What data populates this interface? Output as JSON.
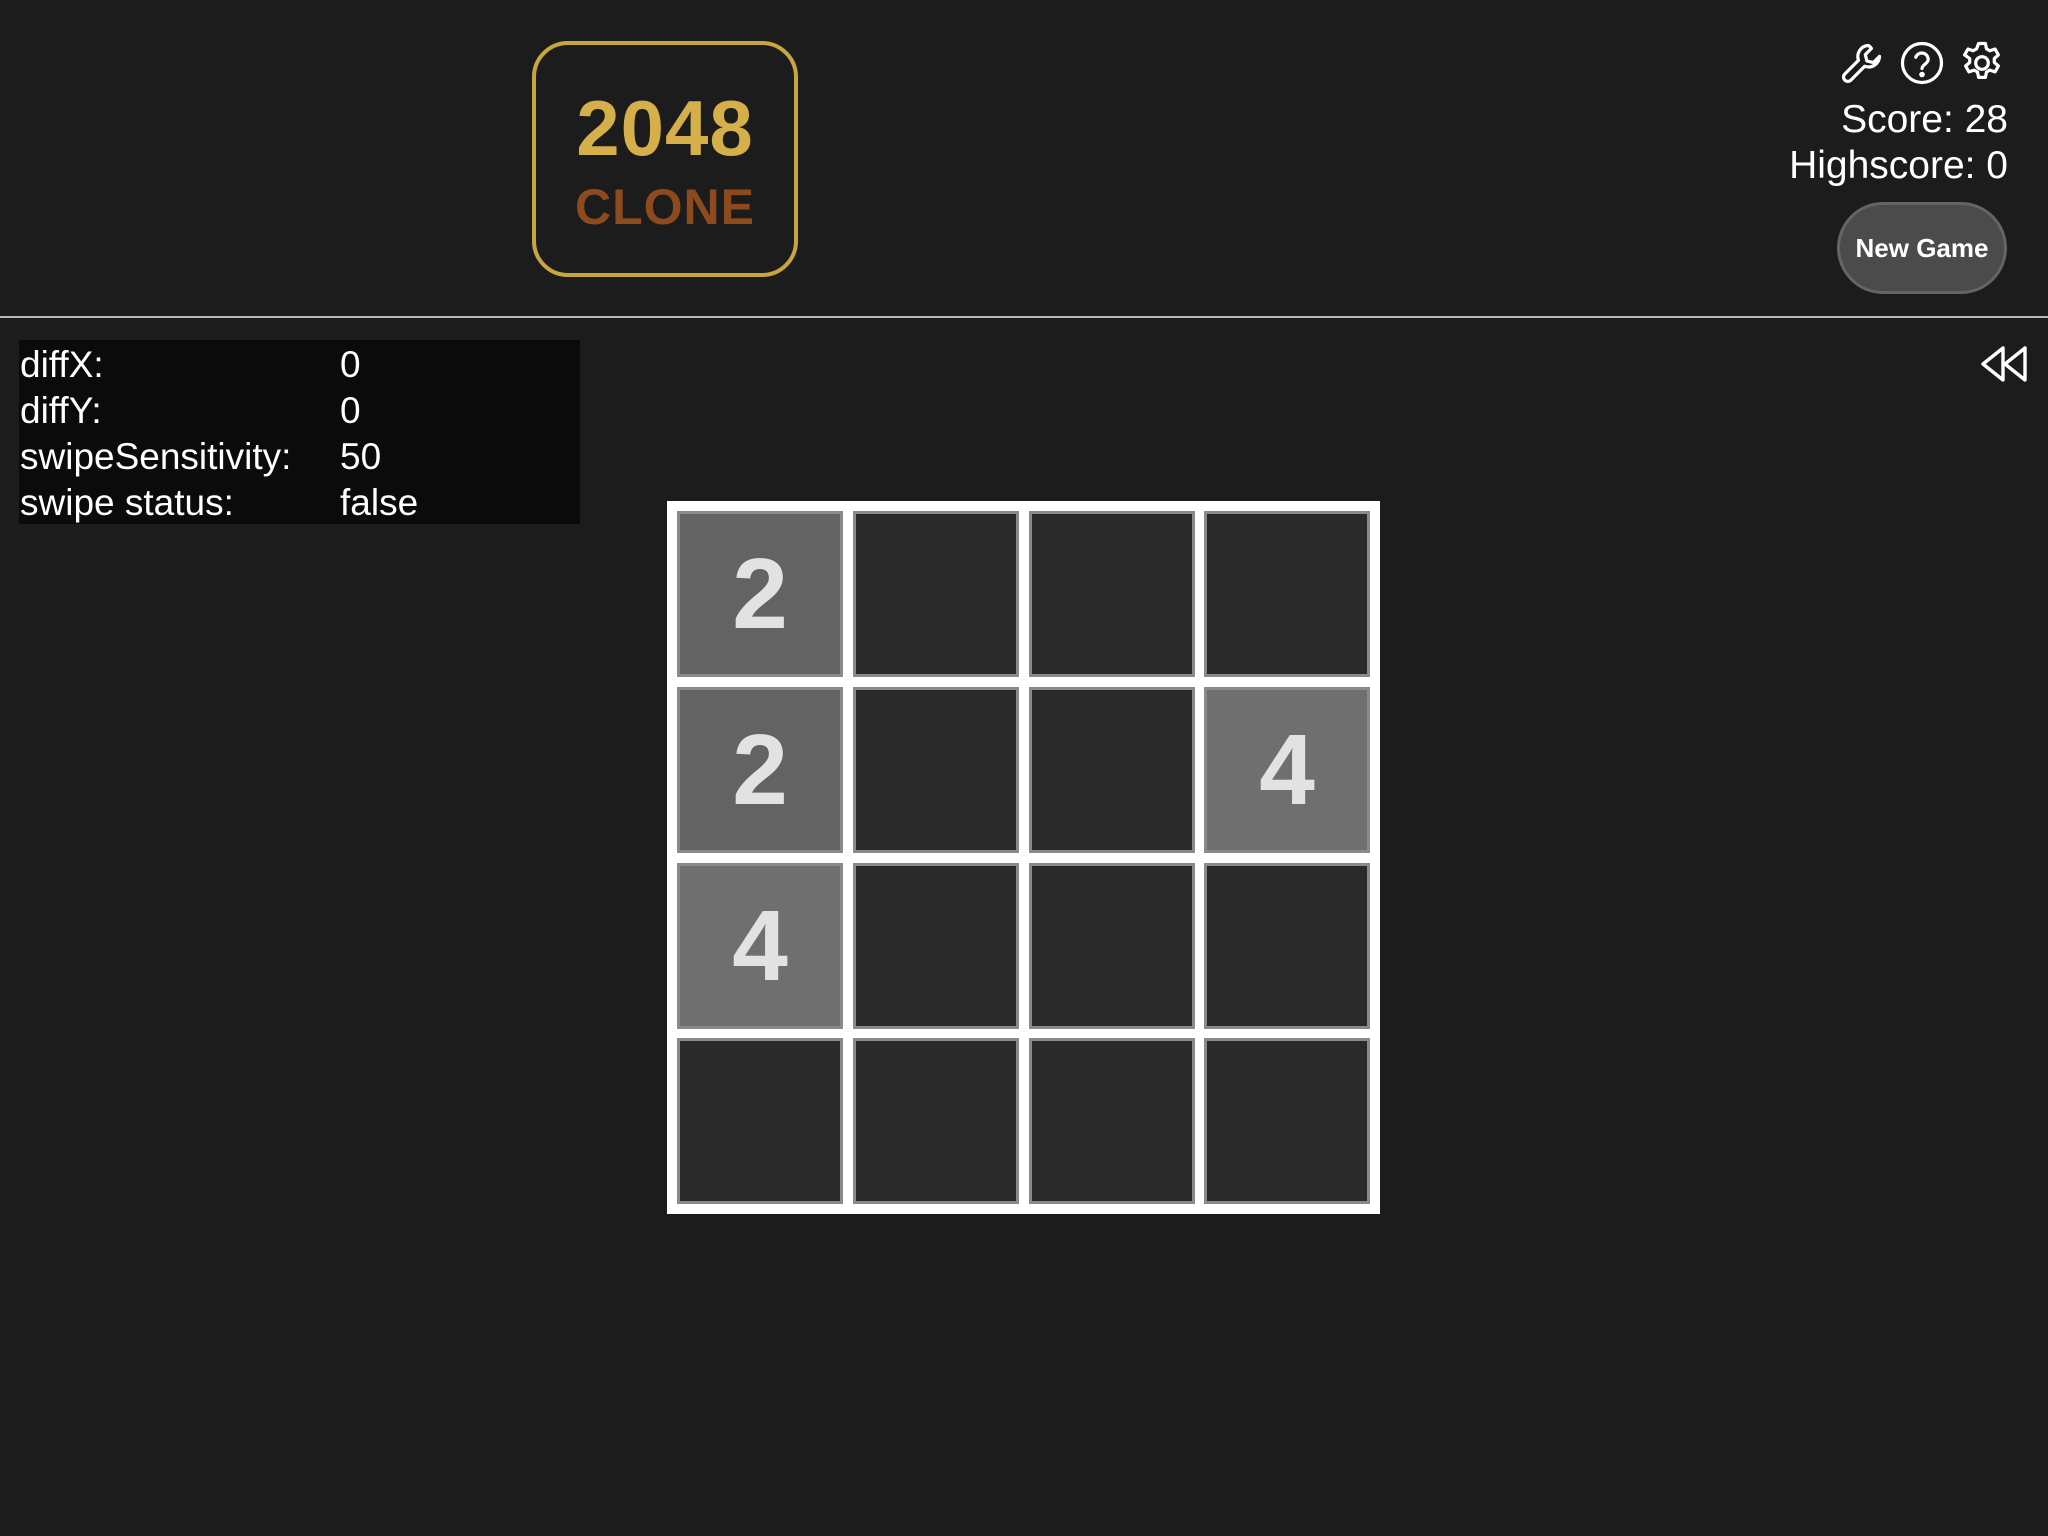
{
  "header": {
    "logo": {
      "number": "2048",
      "subtitle": "CLONE"
    },
    "icons": [
      "wrench-icon",
      "help-icon",
      "gear-icon"
    ],
    "score_text": "Score: 28",
    "highscore_text": "Highscore: 0",
    "new_game_label": "New Game"
  },
  "debug": [
    {
      "label": "diffX:",
      "value": "0"
    },
    {
      "label": "diffY:",
      "value": "0"
    },
    {
      "label": "swipeSensitivity:",
      "value": "50"
    },
    {
      "label": "swipe status:",
      "value": "false"
    }
  ],
  "undo_icon": "rewind-icon",
  "board": {
    "size": 4,
    "cells": [
      [
        "2",
        "",
        "",
        ""
      ],
      [
        "2",
        "",
        "",
        "4"
      ],
      [
        "4",
        "",
        "",
        ""
      ],
      [
        "",
        "",
        "",
        ""
      ]
    ]
  },
  "colors": {
    "background": "#1c1c1c",
    "logo_gold": "#d4af4a",
    "logo_brown": "#8d4b1d",
    "empty_cell": "#2a2a2a",
    "tile_2": "#636363",
    "tile_4": "#6f6f6f",
    "board_grid": "#ffffff",
    "button_bg": "#4b4b4b"
  }
}
